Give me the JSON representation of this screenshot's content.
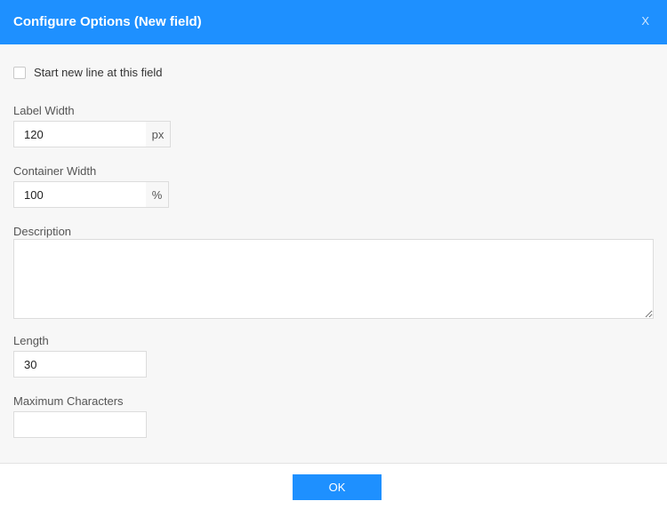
{
  "dialog": {
    "title": "Configure Options (New field)",
    "close_label": "X"
  },
  "options": {
    "start_new_line": {
      "label": "Start new line at this field",
      "checked": false
    },
    "label_width": {
      "label": "Label Width",
      "value": "120",
      "unit": "px"
    },
    "container_width": {
      "label": "Container Width",
      "value": "100",
      "unit": "%"
    },
    "description": {
      "label": "Description",
      "value": ""
    },
    "length": {
      "label": "Length",
      "value": "30"
    },
    "max_chars": {
      "label": "Maximum Characters",
      "value": ""
    }
  },
  "footer": {
    "ok_label": "OK"
  },
  "colors": {
    "accent": "#1e90ff",
    "background": "#f7f7f7"
  }
}
